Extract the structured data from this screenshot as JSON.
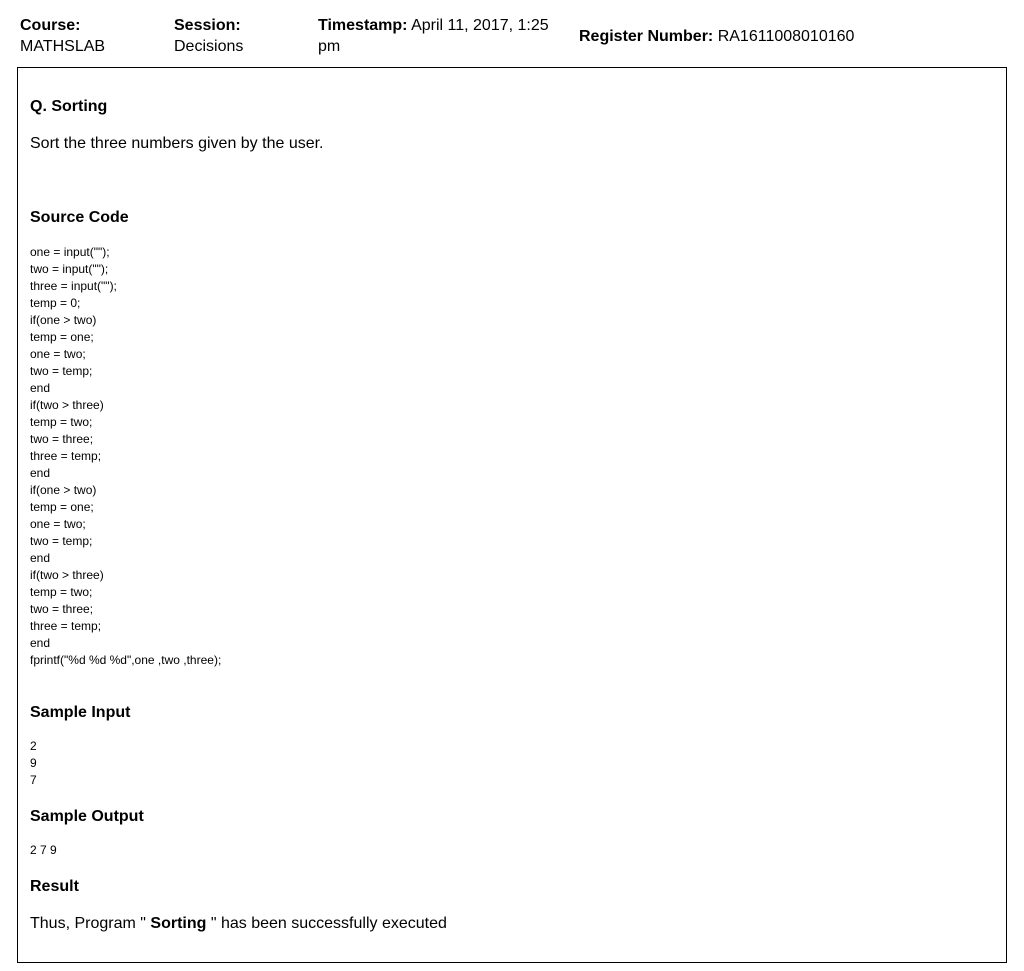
{
  "header": {
    "course_label": "Course:",
    "course_value": "MATHSLAB",
    "session_label": "Session:",
    "session_value": "Decisions",
    "timestamp_label": "Timestamp:",
    "timestamp_value": "April 11, 2017, 1:25 pm",
    "register_label": "Register Number:",
    "register_value": "RA1611008010160"
  },
  "question": {
    "title": "Q. Sorting",
    "description": "Sort the three numbers given by the user."
  },
  "source_code": {
    "title": "Source Code",
    "lines": [
      "one = input(\"\");",
      "two = input(\"\");",
      "three = input(\"\");",
      "temp = 0;",
      "if(one > two)",
      "temp = one;",
      "one = two;",
      "two = temp;",
      "end",
      "if(two > three)",
      "temp = two;",
      "two = three;",
      "three = temp;",
      "end",
      "if(one > two)",
      "temp = one;",
      "one = two;",
      "two = temp;",
      "end",
      "if(two > three)",
      "temp = two;",
      "two = three;",
      "three = temp;",
      "end",
      "fprintf(\"%d %d %d\",one ,two ,three);"
    ]
  },
  "sample_input": {
    "title": "Sample Input",
    "lines": [
      "2",
      "9",
      "7"
    ]
  },
  "sample_output": {
    "title": "Sample Output",
    "lines": [
      "2 7 9"
    ]
  },
  "result": {
    "title": "Result",
    "prefix": "Thus, Program \" ",
    "program_name": "Sorting",
    "suffix": " \" has been successfully executed"
  }
}
